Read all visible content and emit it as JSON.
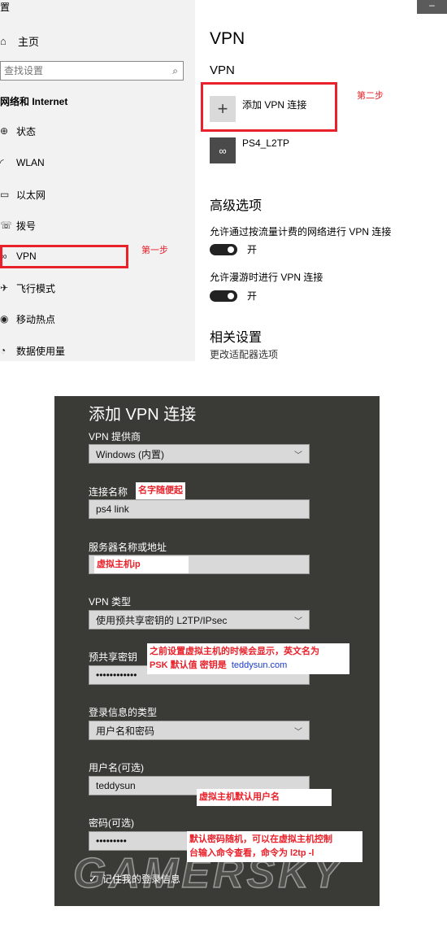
{
  "settings": {
    "sidebar": {
      "title_fragment": "置",
      "home": "主页",
      "search_placeholder": "查找设置",
      "section": "网络和 Internet",
      "items": [
        {
          "label": "状态",
          "icon": "globe-icon"
        },
        {
          "label": "WLAN",
          "icon": "wifi-icon"
        },
        {
          "label": "以太网",
          "icon": "ethernet-icon"
        },
        {
          "label": "拨号",
          "icon": "dialup-icon"
        },
        {
          "label": "VPN",
          "icon": "vpn-icon"
        },
        {
          "label": "飞行模式",
          "icon": "airplane-icon"
        },
        {
          "label": "移动热点",
          "icon": "hotspot-icon"
        },
        {
          "label": "数据使用量",
          "icon": "data-usage-icon"
        }
      ],
      "step1_note": "第一步"
    },
    "window_minimize": "–",
    "main": {
      "title": "VPN",
      "subtitle": "VPN",
      "add_vpn": "添加 VPN 连接",
      "step2_note": "第二步",
      "connection": "PS4_L2TP",
      "advanced_title": "高级选项",
      "option1": "允许通过按流量计费的网络进行 VPN 连接",
      "option1_state": "开",
      "option2": "允许漫游时进行 VPN 连接",
      "option2_state": "开",
      "related_title": "相关设置",
      "related_link": "更改适配器选项"
    }
  },
  "dialog": {
    "title": "添加 VPN 连接",
    "provider_label": "VPN 提供商",
    "provider_value": "Windows (内置)",
    "name_label": "连接名称",
    "name_note": "名字随便起",
    "name_value": "ps4 link",
    "server_label": "服务器名称或地址",
    "server_note": "虚拟主机ip",
    "type_label": "VPN 类型",
    "type_value": "使用预共享密钥的 L2TP/IPsec",
    "psk_label": "预共享密钥",
    "psk_value": "••••••••••••",
    "psk_note_line1": "之前设置虚拟主机的时候会显示，英文名为",
    "psk_note_line2": "PSK 默认值 密钥是",
    "psk_note_key": "teddysun.com",
    "signin_label": "登录信息的类型",
    "signin_value": "用户名和密码",
    "username_label": "用户名(可选)",
    "username_value": "teddysun",
    "username_note": "虚拟主机默认用户名",
    "password_label": "密码(可选)",
    "password_value": "•••••••••",
    "password_note_line1": "默认密码随机，可以在虚拟主机控制",
    "password_note_line2": "台输入命令查看，命令为 l2tp -l",
    "remember": "记住我的登录信息",
    "watermark": "GAMERSKY"
  }
}
